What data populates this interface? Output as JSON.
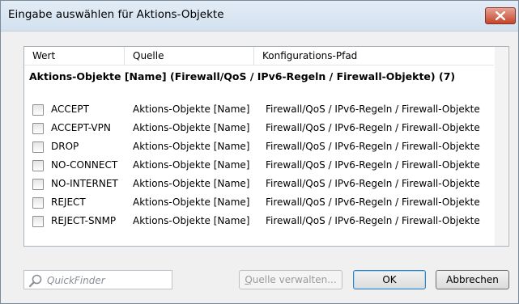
{
  "dialog": {
    "title": "Eingabe auswählen für Aktions-Objekte"
  },
  "table": {
    "columns": [
      "Wert",
      "Quelle",
      "Konfigurations-Pfad"
    ],
    "group_label": "Aktions-Objekte [Name] (Firewall/QoS / IPv6-Regeln / Firewall-Objekte) (7)",
    "rows": [
      {
        "wert": "ACCEPT",
        "quelle": "Aktions-Objekte [Name]",
        "pfad": "Firewall/QoS / IPv6-Regeln / Firewall-Objekte",
        "checked": false
      },
      {
        "wert": "ACCEPT-VPN",
        "quelle": "Aktions-Objekte [Name]",
        "pfad": "Firewall/QoS / IPv6-Regeln / Firewall-Objekte",
        "checked": false
      },
      {
        "wert": "DROP",
        "quelle": "Aktions-Objekte [Name]",
        "pfad": "Firewall/QoS / IPv6-Regeln / Firewall-Objekte",
        "checked": false
      },
      {
        "wert": "NO-CONNECT",
        "quelle": "Aktions-Objekte [Name]",
        "pfad": "Firewall/QoS / IPv6-Regeln / Firewall-Objekte",
        "checked": false
      },
      {
        "wert": "NO-INTERNET",
        "quelle": "Aktions-Objekte [Name]",
        "pfad": "Firewall/QoS / IPv6-Regeln / Firewall-Objekte",
        "checked": false
      },
      {
        "wert": "REJECT",
        "quelle": "Aktions-Objekte [Name]",
        "pfad": "Firewall/QoS / IPv6-Regeln / Firewall-Objekte",
        "checked": false
      },
      {
        "wert": "REJECT-SNMP",
        "quelle": "Aktions-Objekte [Name]",
        "pfad": "Firewall/QoS / IPv6-Regeln / Firewall-Objekte",
        "checked": false
      }
    ]
  },
  "footer": {
    "quickfinder_placeholder": "QuickFinder",
    "quelle_label_u": "Q",
    "quelle_label_rest": "uelle verwalten...",
    "ok_label": "OK",
    "cancel_label": "Abbrechen"
  },
  "icons": {
    "close": "close-icon",
    "search": "search-icon",
    "checkbox": "checkbox-icon"
  }
}
